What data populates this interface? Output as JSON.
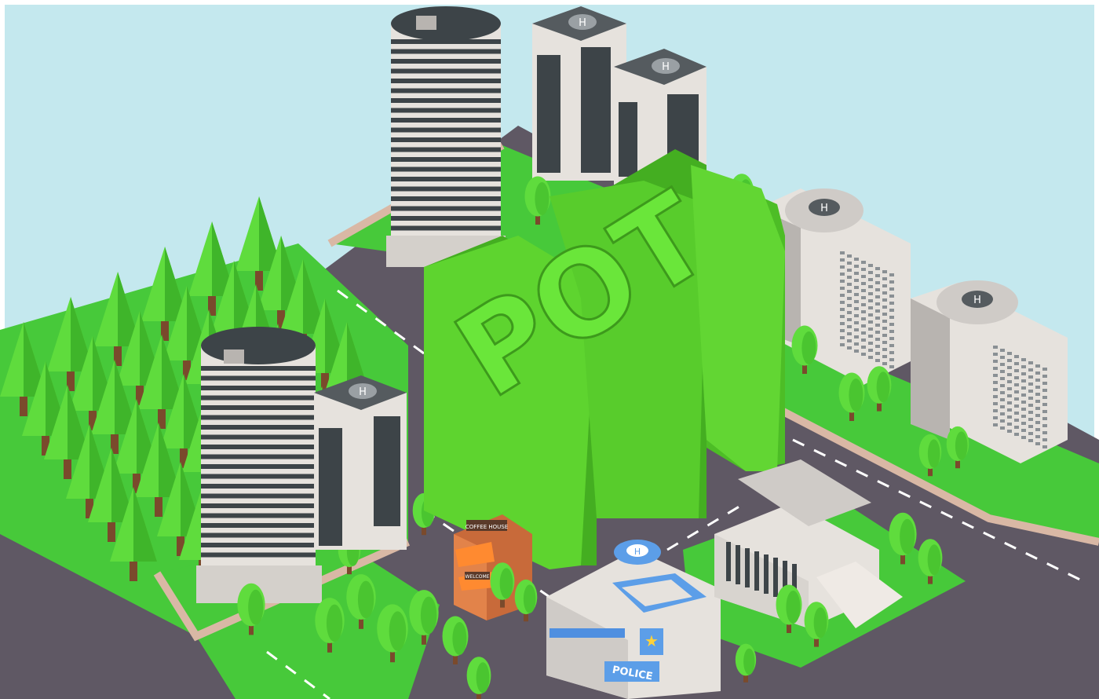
{
  "scene": {
    "big_letters": "POT",
    "police_sign": "POLICE",
    "coffee_sign": "COFFEE HOUSE",
    "welcome_sign": "WELCOME",
    "helipad_mark": "H"
  },
  "colors": {
    "sky": "#c4e8ee",
    "grass": "#47c93a",
    "grass_dark": "#33a82c",
    "road": "#5f5864",
    "sidewalk": "#d9b8a5",
    "tree": "#5fdc3d",
    "tree_dark": "#3fb52a",
    "letters": "#5ed42f",
    "letters_shade": "#44ae21",
    "building_light": "#e6e2dd",
    "building_dark": "#3d4448"
  }
}
